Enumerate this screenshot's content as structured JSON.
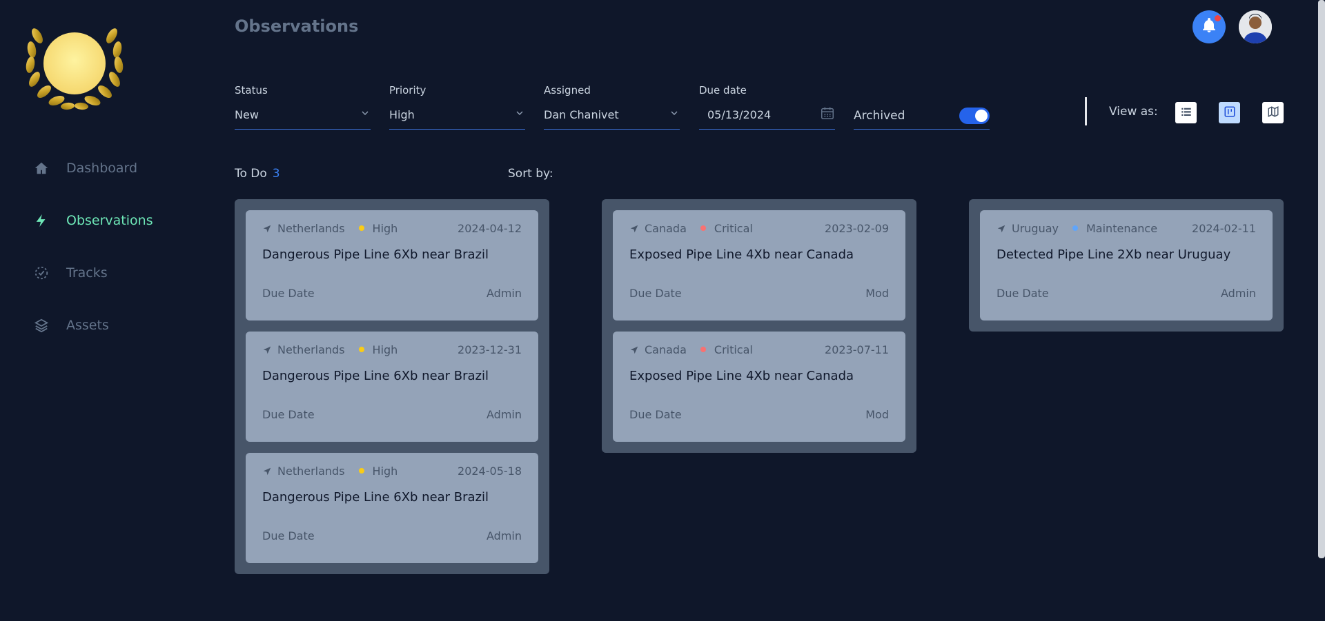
{
  "sidebar": {
    "items": [
      {
        "label": "Dashboard",
        "icon": "home-icon",
        "active": false
      },
      {
        "label": "Observations",
        "icon": "bolt-icon",
        "active": true
      },
      {
        "label": "Tracks",
        "icon": "tracks-icon",
        "active": false
      },
      {
        "label": "Assets",
        "icon": "layers-icon",
        "active": false
      }
    ]
  },
  "header": {
    "title": "Observations"
  },
  "filters": {
    "status": {
      "label": "Status",
      "value": "New"
    },
    "priority": {
      "label": "Priority",
      "value": "High"
    },
    "assigned": {
      "label": "Assigned",
      "value": "Dan Chanivet"
    },
    "due_date": {
      "label": "Due date",
      "value": "05/13/2024"
    },
    "archived": {
      "label": "Archived",
      "on": true
    }
  },
  "view": {
    "label": "View as:",
    "options": [
      "list",
      "board",
      "map"
    ],
    "active": "board"
  },
  "board": {
    "group_label": "To Do",
    "count": "3",
    "sort_label": "Sort by:"
  },
  "columns": [
    {
      "cards": [
        {
          "location": "Netherlands",
          "priority": "High",
          "priority_color": "#facc15",
          "date": "2024-04-12",
          "title": "Dangerous Pipe Line 6Xb near Brazil",
          "due_label": "Due Date",
          "owner": "Admin"
        },
        {
          "location": "Netherlands",
          "priority": "High",
          "priority_color": "#facc15",
          "date": "2023-12-31",
          "title": "Dangerous Pipe Line 6Xb near Brazil",
          "due_label": "Due Date",
          "owner": "Admin"
        },
        {
          "location": "Netherlands",
          "priority": "High",
          "priority_color": "#facc15",
          "date": "2024-05-18",
          "title": "Dangerous Pipe Line 6Xb near Brazil",
          "due_label": "Due Date",
          "owner": "Admin"
        }
      ]
    },
    {
      "cards": [
        {
          "location": "Canada",
          "priority": "Critical",
          "priority_color": "#f87171",
          "date": "2023-02-09",
          "title": "Exposed Pipe Line 4Xb near Canada",
          "due_label": "Due Date",
          "owner": "Mod"
        },
        {
          "location": "Canada",
          "priority": "Critical",
          "priority_color": "#f87171",
          "date": "2023-07-11",
          "title": "Exposed Pipe Line 4Xb near Canada",
          "due_label": "Due Date",
          "owner": "Mod"
        }
      ]
    },
    {
      "cards": [
        {
          "location": "Uruguay",
          "priority": "Maintenance",
          "priority_color": "#60a5fa",
          "date": "2024-02-11",
          "title": "Detected Pipe Line 2Xb near Uruguay",
          "due_label": "Due Date",
          "owner": "Admin"
        }
      ]
    }
  ],
  "colors": {
    "accent": "#3b82f6",
    "active_nav": "#6ee7b7",
    "background": "#0f172a"
  }
}
